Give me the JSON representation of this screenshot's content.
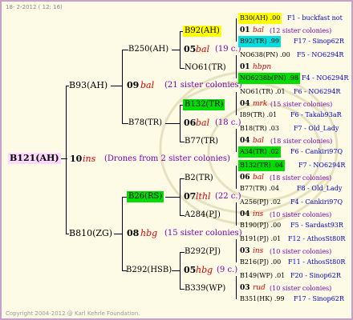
{
  "header": {
    "date": "18- 2-2012 ( 12: 16)"
  },
  "footer": {
    "copyright": "Copyright 2004-2012 @ Karl Kehrle Foundation."
  },
  "root": {
    "label": "B121(AH)"
  },
  "gen1": {
    "mid": {
      "num": "10",
      "code": "ins",
      "note": "(Drones from 2 sister colonies)"
    },
    "top": {
      "label": "B93(AH)",
      "num": "09",
      "code": "bal",
      "note": "(21 sister colonies)"
    },
    "bottom": {
      "label": "B810(ZG)",
      "num": "08",
      "code": "hbg",
      "note": "(15 sister colonies)"
    }
  },
  "gen2": [
    {
      "label": "B250(AH)",
      "num": "05",
      "code": "bal",
      "note": "(19 c.)"
    },
    {
      "label": "B78(TR)",
      "num": "06",
      "code": "bal",
      "note": "(18 c.)"
    },
    {
      "label": "B26(RS)",
      "num": "07",
      "code": "lthl",
      "note": "(22 c.)"
    },
    {
      "label": "B292(HSB)",
      "num": "05",
      "code": "hbg",
      "note": "(9 c.)"
    }
  ],
  "gen3": [
    {
      "label": "B92(AH)",
      "num": "01",
      "code": "bal",
      "note": "(12 sister colonies)"
    },
    {
      "label": "NO61(TR)",
      "num": "01",
      "code": "hbpn",
      "note": ""
    },
    {
      "label": "B132(TR)",
      "num": "04",
      "code": "mrk",
      "note": "(15 sister colonies)"
    },
    {
      "label": "B77(TR)",
      "num": "04",
      "code": "bal",
      "note": "(18 sister colonies)"
    },
    {
      "label": "B2(TR)",
      "num": "06",
      "code": "bal",
      "note": "(18 sister colonies)"
    },
    {
      "label": "A284(PJ)",
      "num": "04",
      "code": "ins",
      "note": "(10 sister colonies)"
    },
    {
      "label": "B292(PJ)",
      "num": "03",
      "code": "ins",
      "note": "(10 sister colonies)"
    },
    {
      "label": "B339(WP)",
      "num": "03",
      "code": "rud",
      "note": "(10 sister colonies)"
    }
  ],
  "gen4": [
    {
      "label": "B30(AH) .00",
      "drone": "F1 - buckfast not"
    },
    {
      "label": "B92(TR) .99",
      "drone": "F17 - Sinop62R"
    },
    {
      "label": "NO638(PN) .00",
      "drone": "F5 - NO6294R"
    },
    {
      "label": "NO6238b(PN) .98",
      "drone": "F4 - NO6294R"
    },
    {
      "label": "NO61(TR) .01",
      "drone": "F6 - NO6294R"
    },
    {
      "label": "I89(TR) .01",
      "drone": "F6 - Takab93aR"
    },
    {
      "label": "B18(TR) .03",
      "drone": "F7 - Old_Lady"
    },
    {
      "label": "A34(TR) .02",
      "drone": "F6 - Cankiri97Q"
    },
    {
      "label": "B132(TR) .04",
      "drone": "F7 - NO6294R"
    },
    {
      "label": "B77(TR) .04",
      "drone": "F8 - Old_Lady"
    },
    {
      "label": "A256(PJ) .02",
      "drone": "F4 - Cankiri97Q"
    },
    {
      "label": "B190(PJ) .00",
      "drone": "F5 - Sardast93R"
    },
    {
      "label": "B191(PJ) .01",
      "drone": "F12 - AthosSt80R"
    },
    {
      "label": "B216(PJ) .00",
      "drone": "F11 - AthosSt80R"
    },
    {
      "label": "B149(WP) .01",
      "drone": "F20 - Sinop62R"
    },
    {
      "label": "B351(HK) .99",
      "drone": "F17 - Sinop62R"
    }
  ]
}
